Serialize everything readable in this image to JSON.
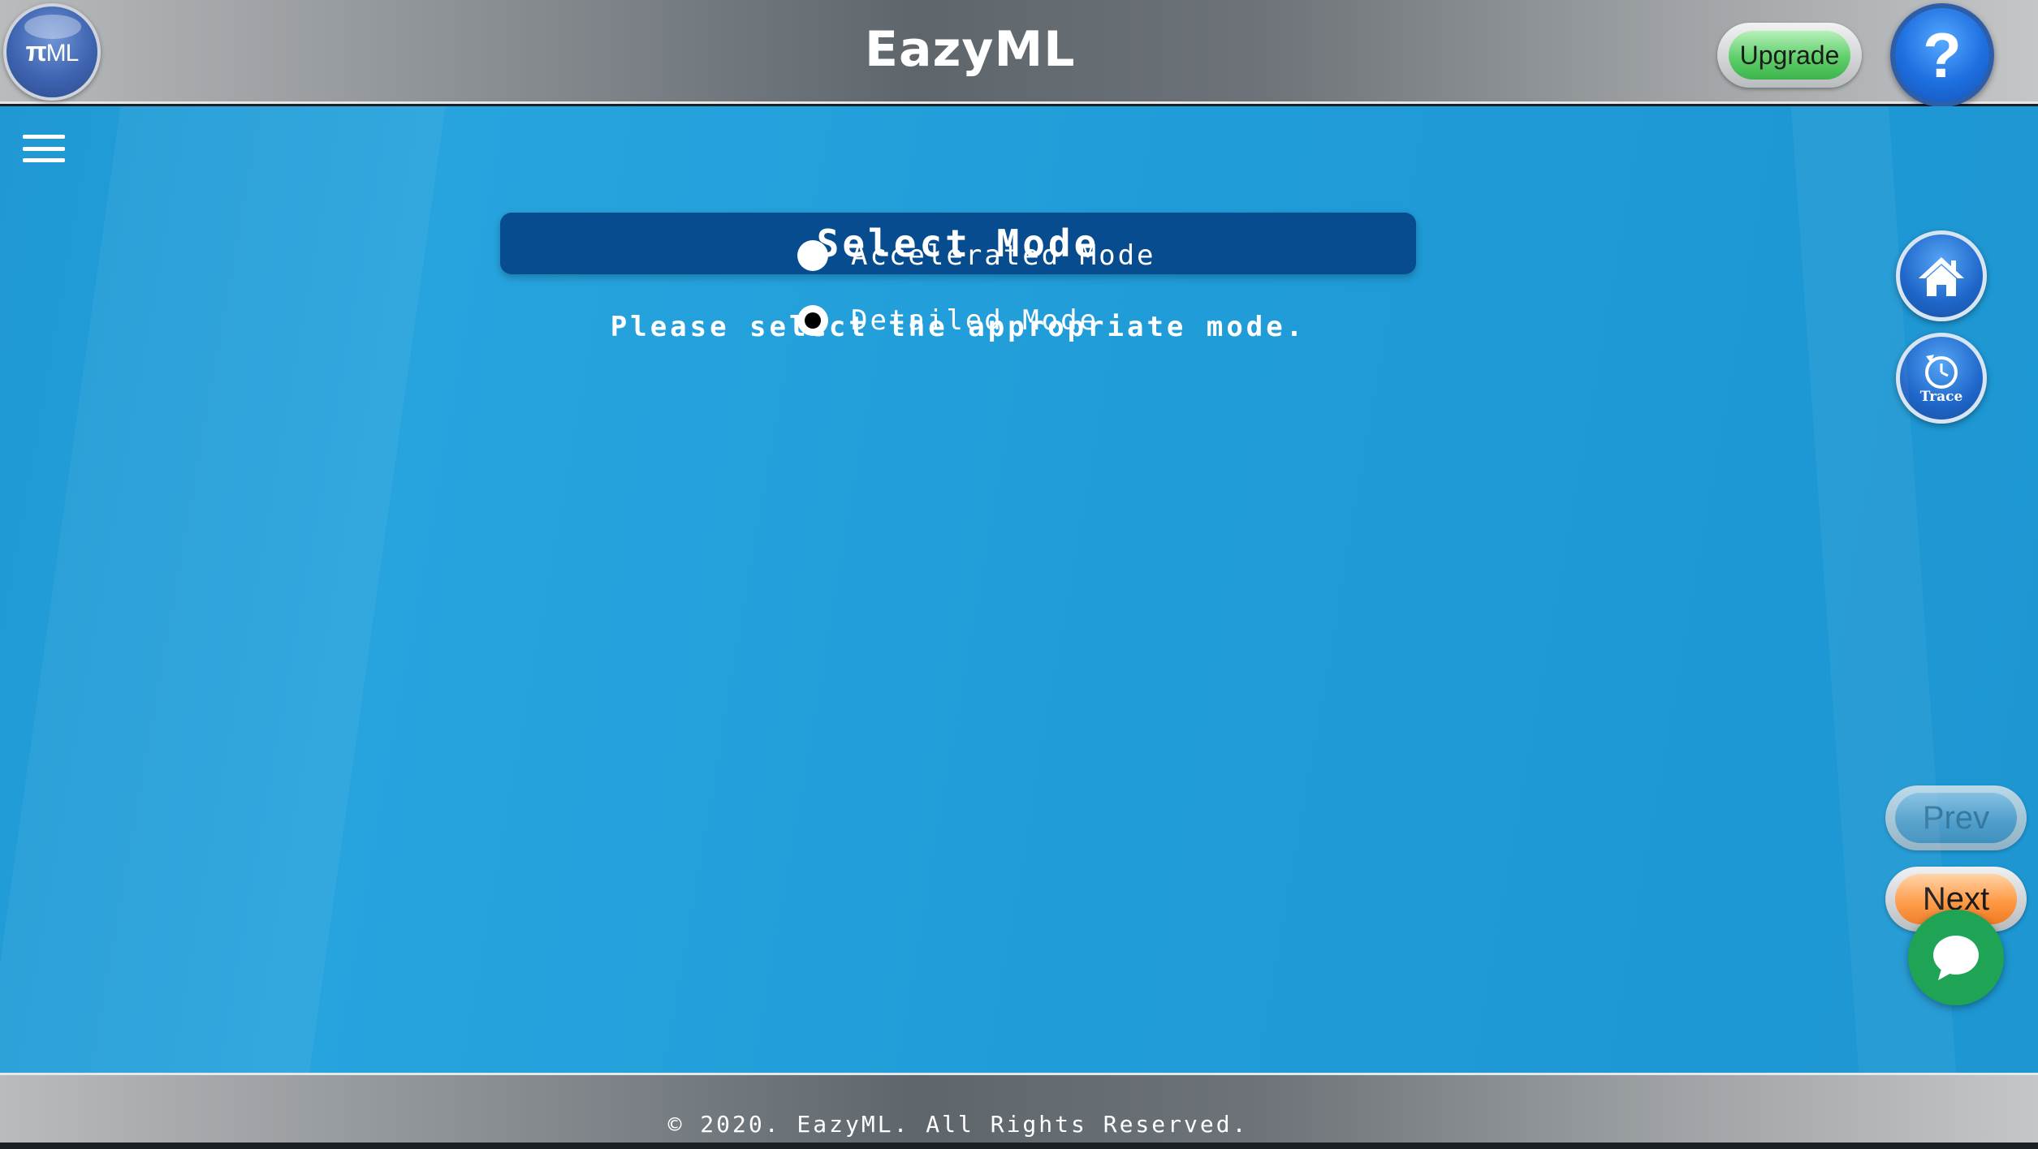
{
  "header": {
    "logo_pi": "π",
    "logo_ml": "ML",
    "title": "EazyML",
    "upgrade_label": "Upgrade",
    "help_label": "?"
  },
  "main": {
    "mode_title": "Select Mode",
    "instruction": "Please select the appropriate mode.",
    "modes": [
      {
        "label": "Accelerated Mode",
        "selected": false
      },
      {
        "label": "Detailed Mode",
        "selected": true
      }
    ]
  },
  "side": {
    "home_icon": "home-icon",
    "trace_label": "Trace"
  },
  "nav": {
    "prev_label": "Prev",
    "next_label": "Next"
  },
  "footer": {
    "copyright": "© 2020. EazyML. All Rights Reserved."
  },
  "colors": {
    "main_bg": "#22a0da",
    "mode_header_bg": "#064c8e",
    "upgrade_green": "#5fcf6a",
    "next_orange": "#ff9a45",
    "chat_green": "#1fa456"
  }
}
